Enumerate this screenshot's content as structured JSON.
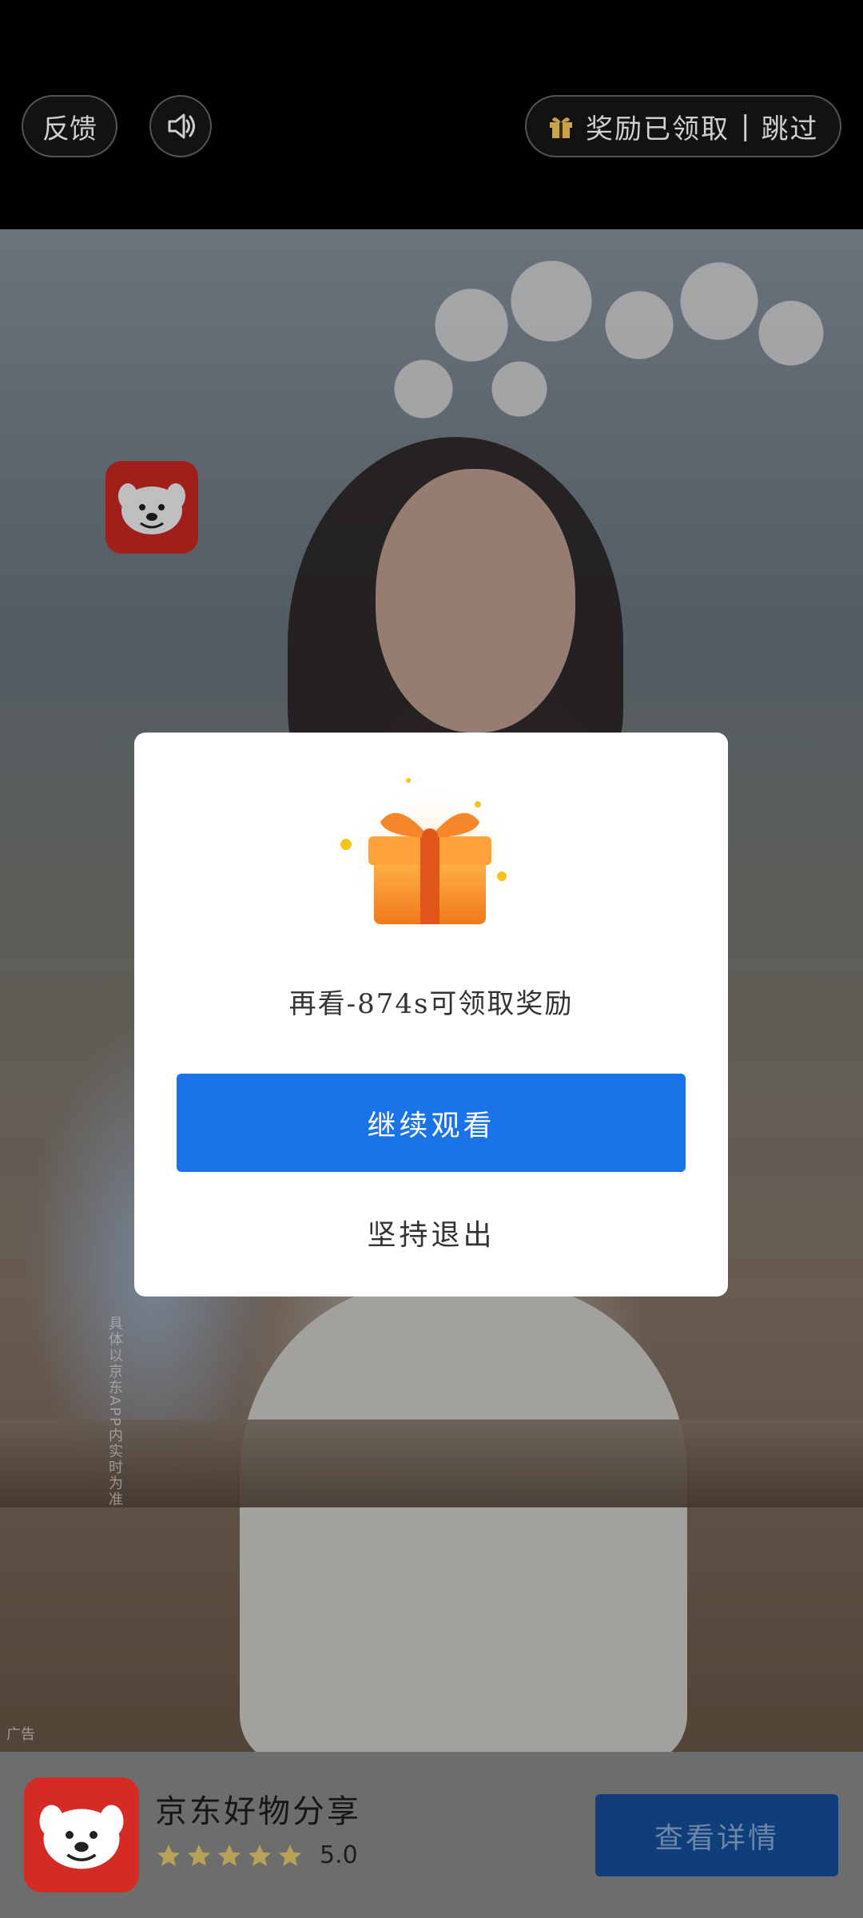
{
  "topbar": {
    "feedback_label": "反馈",
    "reward_label": "奖励已领取",
    "skip_label": "跳过",
    "separator": "|"
  },
  "ad": {
    "tag": "广告",
    "vertical_note": "具体以京东APP内实时为准"
  },
  "modal": {
    "message": "再看-874s可领取奖励",
    "continue_label": "继续观看",
    "quit_label": "坚持退出"
  },
  "bottom_card": {
    "app_name": "京东好物分享",
    "rating": "5.0",
    "stars": 5,
    "detail_button": "查看详情"
  },
  "colors": {
    "primary_blue": "#1b73e8",
    "gift_orange": "#f08a24",
    "jd_red": "#d42b24",
    "star_yellow": "#b8a25a"
  },
  "icons": [
    "speaker-icon",
    "gift-icon",
    "jd-dog-logo",
    "star-icon"
  ]
}
